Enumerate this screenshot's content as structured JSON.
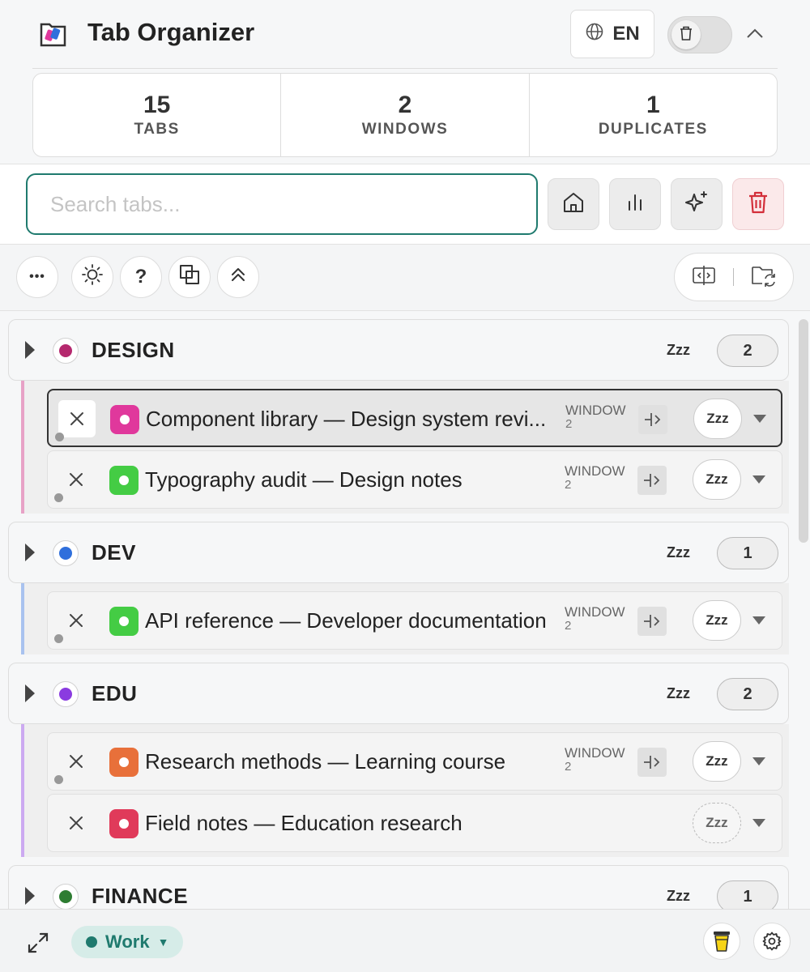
{
  "header": {
    "title": "Tab Organizer",
    "lang_label": "EN"
  },
  "stats": [
    {
      "value": "15",
      "label": "TABS"
    },
    {
      "value": "2",
      "label": "WINDOWS"
    },
    {
      "value": "1",
      "label": "DUPLICATES"
    }
  ],
  "search": {
    "placeholder": "Search tabs...",
    "value": ""
  },
  "toolbar2": {
    "more_label": "•••",
    "help_label": "?"
  },
  "groups": [
    {
      "name": "DESIGN",
      "color": "#b5286e",
      "sleep_label": "Zzz",
      "count": "2",
      "border_color": "#e7a2c6",
      "tabs": [
        {
          "title": "Component library — Design system revi...",
          "favicon_color": "#e0389c",
          "window_label": "WINDOW",
          "window_num": "2",
          "sleep_label": "Zzz",
          "active": true
        },
        {
          "title": "Typography audit — Design notes",
          "favicon_color": "#44cc44",
          "window_label": "WINDOW",
          "window_num": "2",
          "sleep_label": "Zzz",
          "active": false
        }
      ]
    },
    {
      "name": "DEV",
      "color": "#2f6fdc",
      "sleep_label": "Zzz",
      "count": "1",
      "border_color": "#a9c2ef",
      "tabs": [
        {
          "title": "API reference — Developer documentation",
          "favicon_color": "#44cc44",
          "window_label": "WINDOW",
          "window_num": "2",
          "sleep_label": "Zzz",
          "active": false
        }
      ]
    },
    {
      "name": "EDU",
      "color": "#8a3be0",
      "sleep_label": "Zzz",
      "count": "2",
      "border_color": "#ccaaf1",
      "tabs": [
        {
          "title": "Research methods — Learning course",
          "favicon_color": "#e8703a",
          "window_label": "WINDOW",
          "window_num": "2",
          "sleep_label": "Zzz",
          "active": false
        },
        {
          "title": "Field notes — Education research",
          "favicon_color": "#e03a5a",
          "window_label": "",
          "window_num": "",
          "sleep_label": "Zzz",
          "active": false
        }
      ]
    },
    {
      "name": "FINANCE",
      "color": "#2e7d32",
      "sleep_label": "Zzz",
      "count": "1"
    }
  ],
  "footer": {
    "workspace_label": "Work",
    "workspace_caret": "▼",
    "workspace_color": "#1f7a6e"
  }
}
